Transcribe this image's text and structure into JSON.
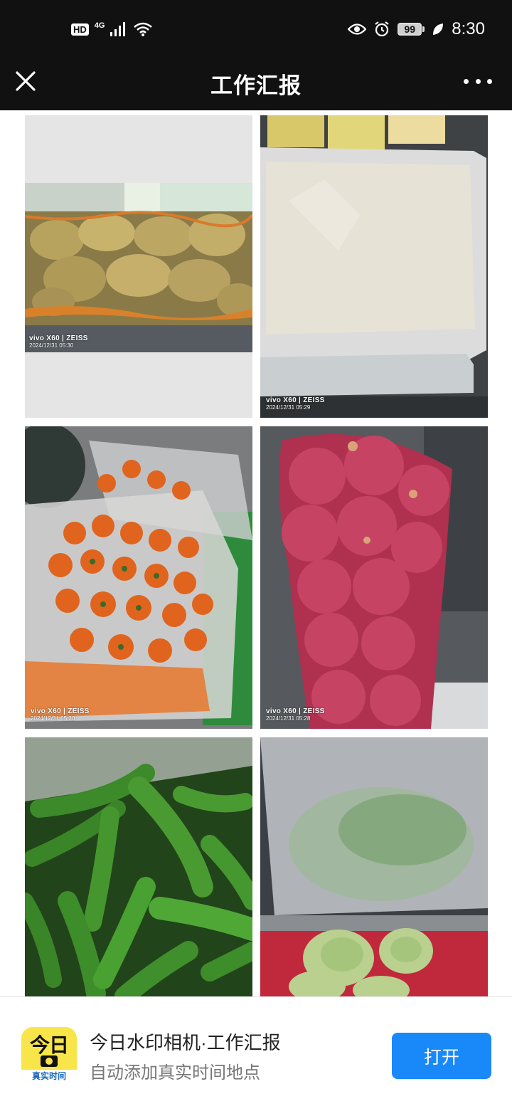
{
  "status_bar": {
    "hd": "HD",
    "network": "4G",
    "battery": "99",
    "time": "8:30"
  },
  "header": {
    "title": "工作汇报"
  },
  "photos": [
    {
      "brand": "vivo X60 | ZEISS",
      "timestamp": "2024/12/31 05:30",
      "subject": "potatoes"
    },
    {
      "brand": "vivo X60 | ZEISS",
      "timestamp": "2024/12/31 05:29",
      "subject": "flour"
    },
    {
      "brand": "vivo X60 | ZEISS",
      "timestamp": "2024/12/31 05:30",
      "subject": "carrots"
    },
    {
      "brand": "vivo X60 | ZEISS",
      "timestamp": "2024/12/31 05:28",
      "subject": "red onions"
    },
    {
      "brand": "",
      "timestamp": "",
      "subject": "green peppers"
    },
    {
      "brand": "",
      "timestamp": "",
      "subject": "cabbage"
    }
  ],
  "banner": {
    "icon_text": "今日",
    "icon_subtext": "真实时间",
    "title": "今日水印相机·工作汇报",
    "subtitle": "自动添加真实时间地点",
    "open_label": "打开"
  },
  "colors": {
    "header_bg": "#111111",
    "accent": "#1989fa",
    "icon_yellow": "#f7e54a"
  }
}
